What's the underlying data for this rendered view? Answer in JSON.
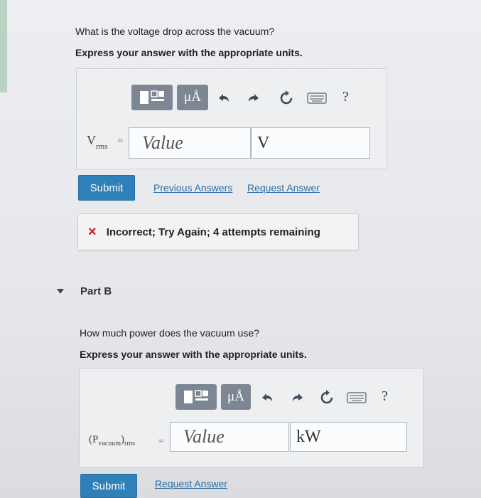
{
  "part_a": {
    "question": "What is the voltage drop across the vacuum?",
    "instruction": "Express your answer with the appropriate units.",
    "toolbar": {
      "units_label": "μÅ",
      "help_label": "?"
    },
    "variable_main": "V",
    "variable_sub": "rms",
    "equals": "=",
    "value_placeholder": "Value",
    "unit_value": "V",
    "submit_label": "Submit",
    "previous_answers_label": "Previous Answers",
    "request_answer_label": "Request Answer",
    "feedback_icon": "×",
    "feedback_text": "Incorrect; Try Again; 4 attempts remaining"
  },
  "part_b": {
    "header": "Part B",
    "question": "How much power does the vacuum use?",
    "instruction": "Express your answer with the appropriate units.",
    "toolbar": {
      "units_label": "μÅ",
      "help_label": "?"
    },
    "variable_open": "(",
    "variable_main": "P",
    "variable_sub_inner": "vacuum",
    "variable_close": ")",
    "variable_sub": "rms",
    "equals": "=",
    "value_placeholder": "Value",
    "unit_value": "kW",
    "submit_label": "Submit",
    "request_answer_label": "Request Answer"
  },
  "colors": {
    "submit_bg": "#2f7fb8",
    "link": "#2b6ba3",
    "error_x": "#c81e1e",
    "toolbar_btn": "#7d8793"
  }
}
